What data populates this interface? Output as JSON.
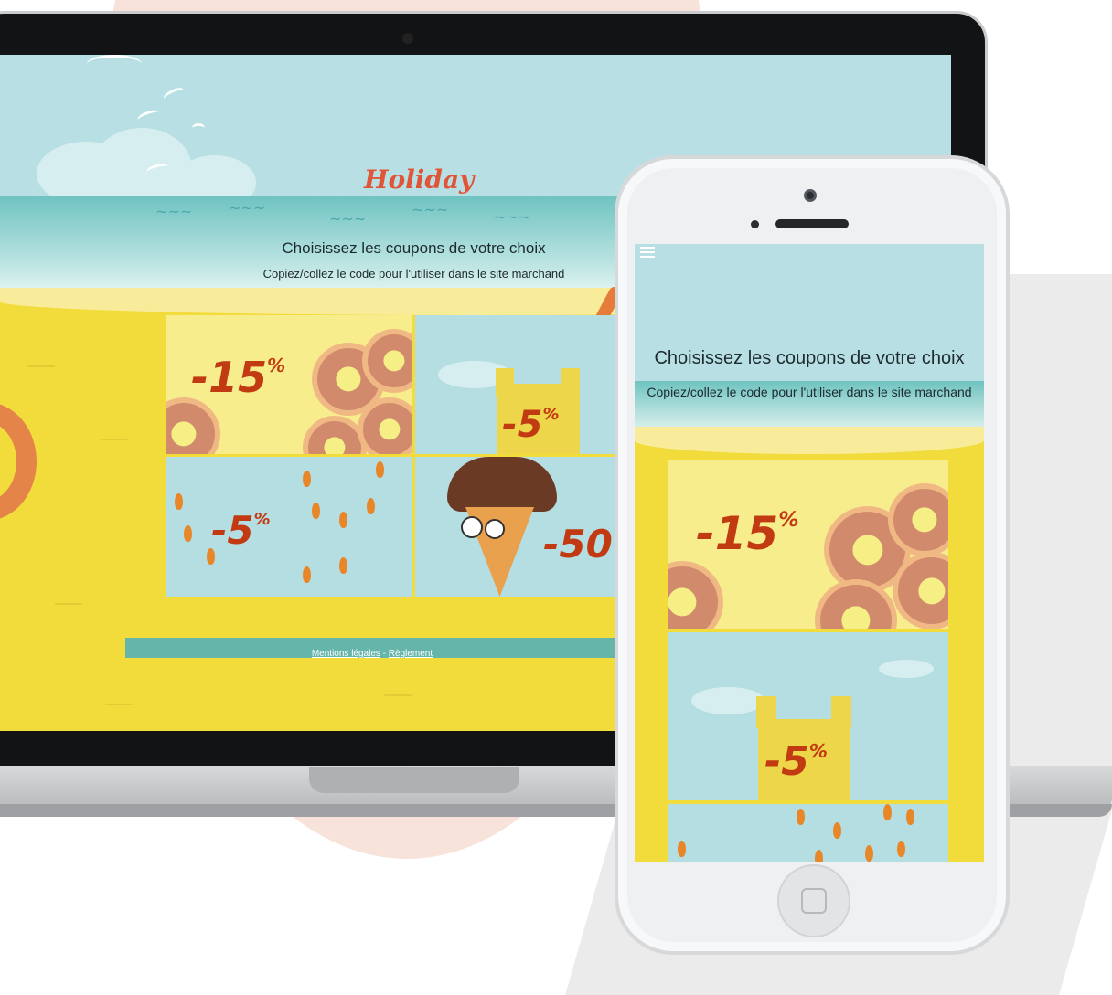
{
  "laptop": {
    "logo_text": "Holiday",
    "title": "Choisissez les coupons de votre choix",
    "subtitle": "Copiez/collez le code pour l'utiliser dans le site marchand",
    "coupons": [
      {
        "discount": "-15",
        "unit": "%",
        "theme": "donuts"
      },
      {
        "discount": "-5",
        "unit": "%",
        "theme": "sandcastle"
      },
      {
        "discount": "-5",
        "unit": "%",
        "theme": "flip-flops"
      },
      {
        "discount": "-50",
        "unit": "",
        "theme": "ice-cream"
      }
    ],
    "footer": {
      "legal_label": "Mentions légales",
      "separator": " - ",
      "rules_label": "Règlement"
    }
  },
  "phone": {
    "title": "Choisissez les coupons de votre choix",
    "subtitle": "Copiez/collez le code pour l'utiliser dans le site marchand",
    "coupons": [
      {
        "discount": "-15",
        "unit": "%",
        "theme": "donuts"
      },
      {
        "discount": "-5",
        "unit": "%",
        "theme": "sandcastle"
      },
      {
        "discount": "",
        "unit": "",
        "theme": "flip-flops"
      }
    ],
    "menu_icon": "hamburger-menu-icon"
  },
  "colors": {
    "sky": "#b8e0e4",
    "sand": "#f2dc3c",
    "accent": "#c13a12",
    "footer": "#66b5ab"
  }
}
